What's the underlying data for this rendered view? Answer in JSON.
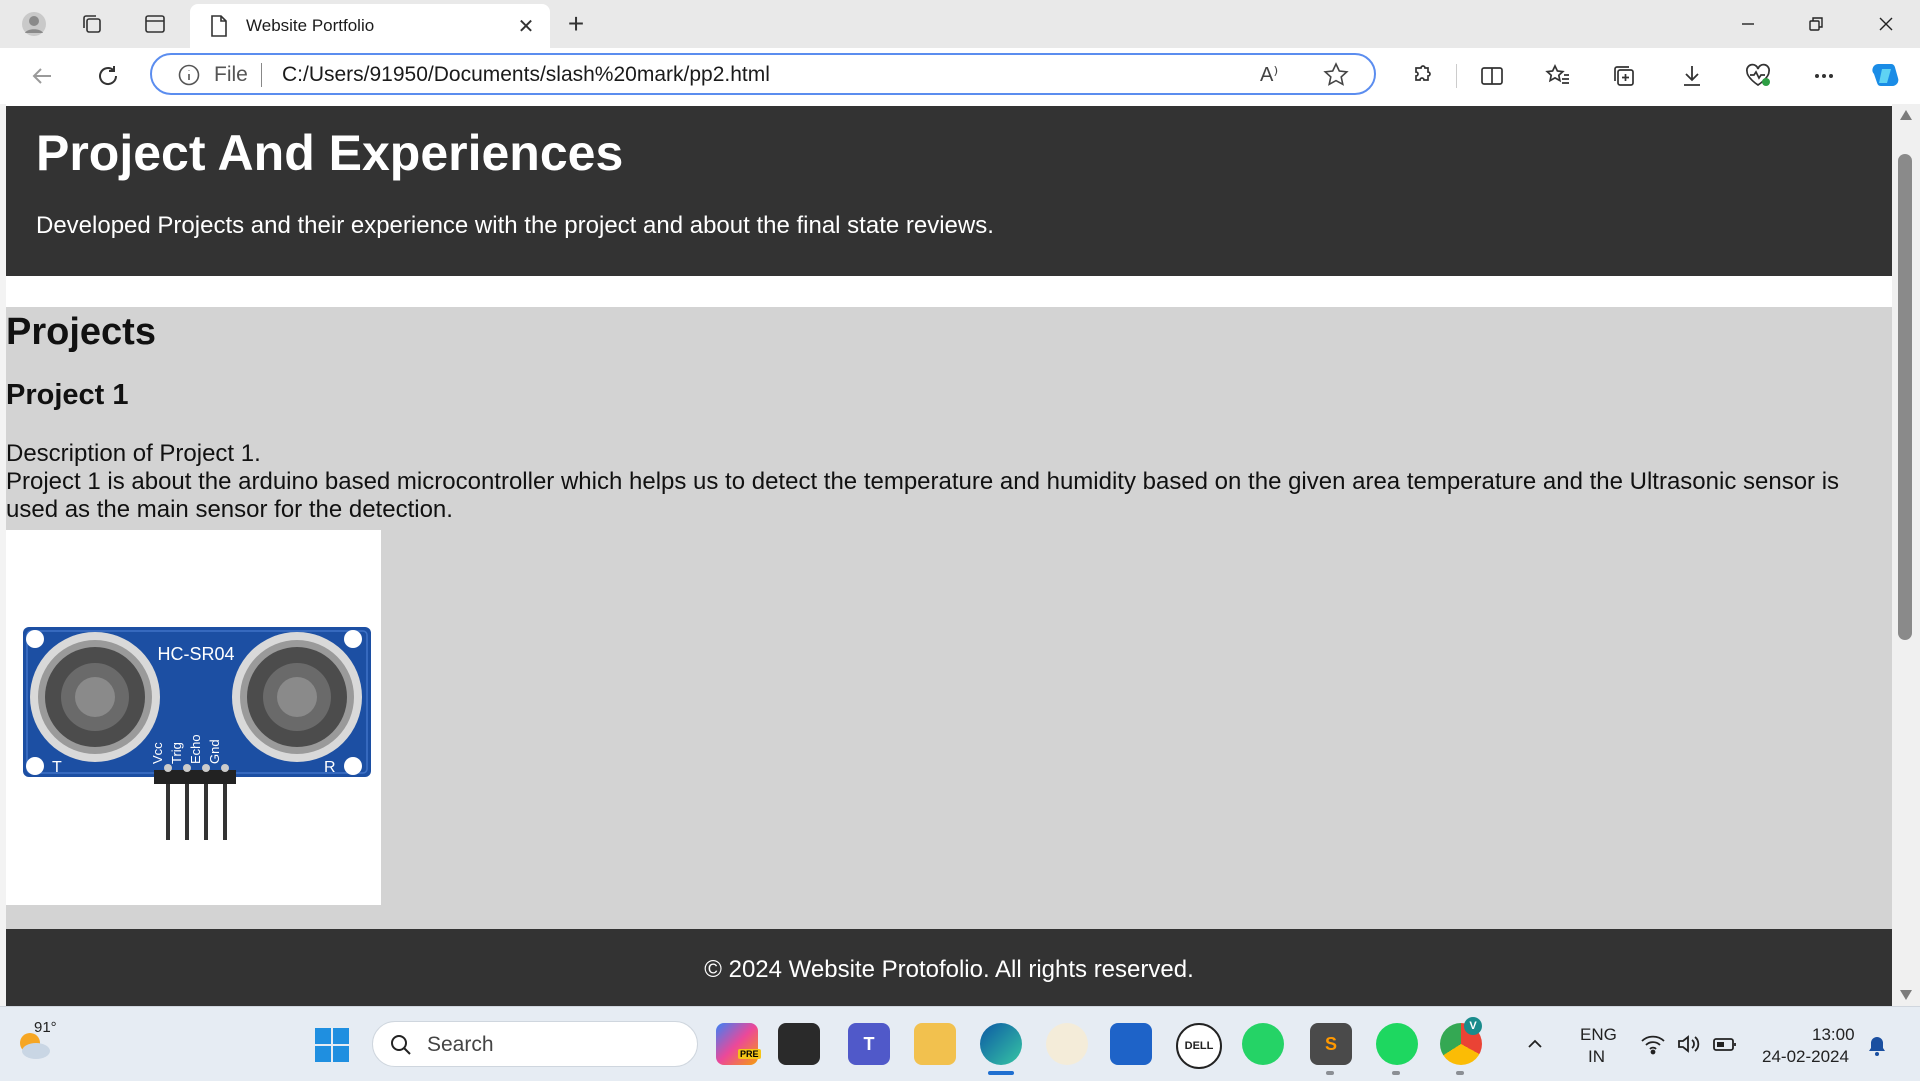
{
  "browser": {
    "tab_title": "Website Portfolio",
    "address_prefix": "File",
    "url": "C:/Users/91950/Documents/slash%20mark/pp2.html",
    "read_aloud_glyph": "A⁾"
  },
  "page": {
    "header_title": "Project And Experiences",
    "header_subtitle": "Developed Projects and their experience with the project and about the final state reviews.",
    "section_title": "Projects",
    "project_title": "Project 1",
    "project_desc_lead": "Description of Project 1.",
    "project_desc_body": "Project 1 is about the arduino based microcontroller which helps us to detect the temperature and humidity based on the given area temperature and the Ultrasonic sensor is used as the main sensor for the detection.",
    "image_sensor_label": "HC-SR04",
    "image_pin_labels": [
      "Vcc",
      "Trig",
      "Echo",
      "Gnd"
    ],
    "image_corner_t": "T",
    "image_corner_r": "R",
    "footer_text": "© 2024 Website Protofolio. All rights reserved."
  },
  "taskbar": {
    "weather_temp": "91°",
    "search_placeholder": "Search",
    "lang_line1": "ENG",
    "lang_line2": "IN",
    "time": "13:00",
    "date": "24-02-2024",
    "copilot_badge": "PRE",
    "chrome_badge": "V"
  },
  "colors": {
    "header_bg": "#333333",
    "section_bg": "#d3d3d3",
    "accent": "#5b8def"
  }
}
